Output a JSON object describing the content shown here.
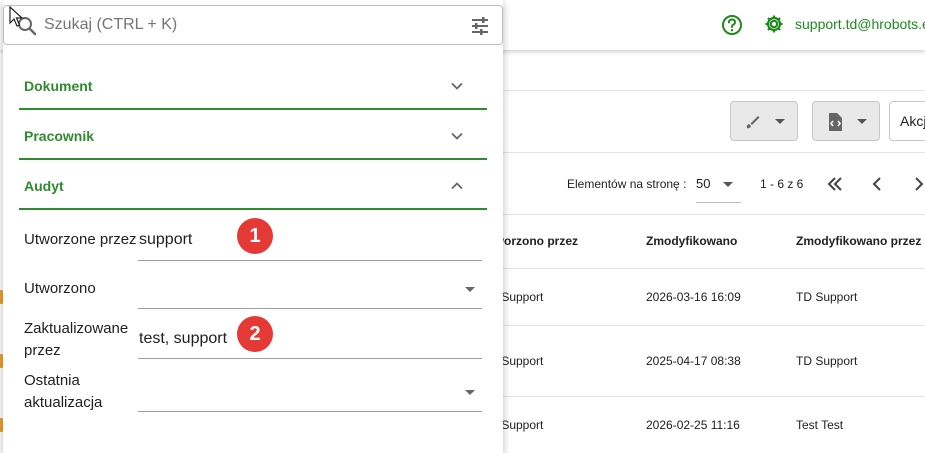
{
  "header": {
    "user_email": "support.td@hrobots.eu"
  },
  "toolbar": {
    "action_label": "Akcje"
  },
  "pager": {
    "label": "Elementów na stronę :",
    "page_size": "50",
    "range": "1 - 6 z 6"
  },
  "table": {
    "columns": [
      "Utworzono przez",
      "Zmodyfikowano",
      "Zmodyfikowano przez"
    ],
    "rows": [
      {
        "created_by": "TD Support",
        "modified": "2026-03-16 16:09",
        "modified_by": "TD Support"
      },
      {
        "created_by": "TD Support",
        "modified": "2025-04-17 08:38",
        "modified_by": "TD Support"
      },
      {
        "created_by": "TD Support",
        "modified": "2026-02-25 11:16",
        "modified_by": "Test Test"
      }
    ]
  },
  "search": {
    "placeholder": "Szukaj (CTRL + K)"
  },
  "filters": {
    "sections": [
      {
        "label": "Dokument",
        "expanded": false
      },
      {
        "label": "Pracownik",
        "expanded": false
      },
      {
        "label": "Audyt",
        "expanded": true
      }
    ],
    "fields": [
      {
        "label": "Utworzone przez",
        "value": "support"
      },
      {
        "label": "Utworzono",
        "value": ""
      },
      {
        "label": "Zaktualizowane przez",
        "value": "test, support"
      },
      {
        "label": "Ostatnia aktualizacja",
        "value": ""
      }
    ]
  },
  "badges": [
    "1",
    "2"
  ],
  "colors": {
    "accent_green": "#2e8b2e",
    "badge_red": "#e53935"
  }
}
